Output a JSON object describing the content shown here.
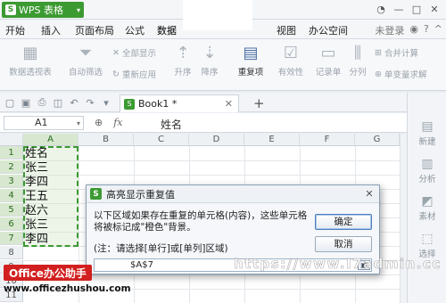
{
  "app": {
    "name": "WPS 表格"
  },
  "menu": {
    "tabs": [
      "开始",
      "插入",
      "页面布局",
      "公式",
      "数据"
    ],
    "tabs_right": [
      "视图",
      "办公空间"
    ],
    "login": "未登录"
  },
  "ribbon": {
    "pivot": "数据透视表",
    "autofilter": "自动筛选",
    "show_all": "全部显示",
    "reapply": "重新应用",
    "asc": "升序",
    "desc": "降序",
    "duplicates": "重复项",
    "validity": "有效性",
    "record": "记录单",
    "split": "分列",
    "merge_calc": "合并计算",
    "simulate": "单变量求解"
  },
  "document": {
    "tab_label": "Book1 *"
  },
  "formula_bar": {
    "name_box": "A1",
    "fx": "fx",
    "content": "姓名"
  },
  "grid": {
    "columns": [
      "A",
      "B",
      "C",
      "D",
      "E",
      "F",
      "G"
    ],
    "rows": [
      "1",
      "2",
      "3",
      "4",
      "5",
      "6",
      "7",
      "8",
      "9",
      "10",
      "11"
    ],
    "cells_a": [
      "姓名",
      "张三",
      "李四",
      "王五",
      "赵六",
      "张三",
      "李四"
    ]
  },
  "sidepanel": {
    "items": [
      "新建",
      "分析",
      "素材",
      "选择"
    ]
  },
  "dialog": {
    "title": "高亮显示重复值",
    "message": "以下区域如果存在重复的单元格(内容)，这些单元格将被标记成\"橙色\"背景。",
    "note": "(注：请选择[单行]或[单列]区域)",
    "ok": "确定",
    "cancel": "取消",
    "range_value": "$A$7"
  },
  "watermark": {
    "brand": "Office办公助手",
    "url": "www.officezhushou.com",
    "url2": "https://www.I7admin.cc"
  }
}
